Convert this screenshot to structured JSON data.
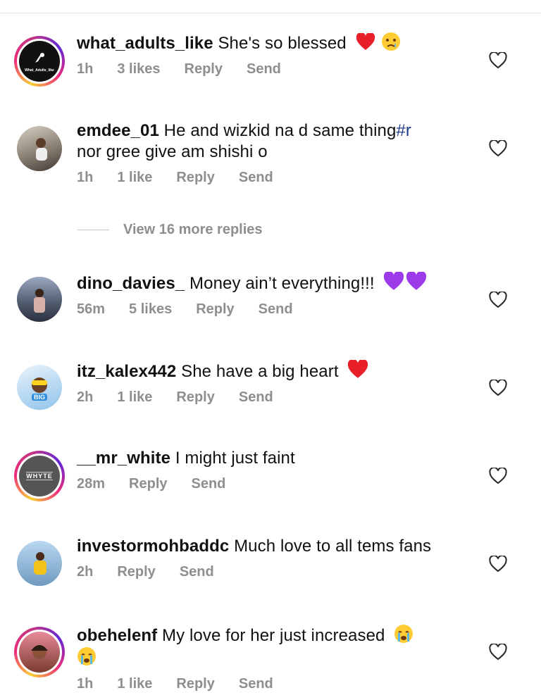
{
  "view_more": "View 16 more replies",
  "comments": [
    {
      "username": "what_adults_like",
      "text": "She's so blessed",
      "time": "1h",
      "likes": "3 likes",
      "reply": "Reply",
      "send": "Send",
      "avatar_text": "What_Adults_like"
    },
    {
      "username": "emdee_01",
      "text": "He and wizkid na d same thing",
      "tag": "#r",
      "text2": "nor gree give am shishi o",
      "time": "1h",
      "likes": "1 like",
      "reply": "Reply",
      "send": "Send"
    },
    {
      "username": "dino_davies_",
      "text": "Money ain’t everything!!!",
      "time": "56m",
      "likes": "5 likes",
      "reply": "Reply",
      "send": "Send"
    },
    {
      "username": "itz_kalex442",
      "text": "She have a big heart",
      "time": "2h",
      "likes": "1 like",
      "reply": "Reply",
      "send": "Send",
      "avatar_text": "BIG"
    },
    {
      "username": "__mr_white",
      "text": "I might just faint",
      "time": "28m",
      "reply": "Reply",
      "send": "Send",
      "avatar_text": "WHYTE"
    },
    {
      "username": "investormohbaddc",
      "text": "Much love to all tems fans",
      "time": "2h",
      "reply": "Reply",
      "send": "Send"
    },
    {
      "username": "obehelenf",
      "text": "My love for her just increased",
      "time": "1h",
      "likes": "1 like",
      "reply": "Reply",
      "send": "Send"
    }
  ],
  "colors": {
    "meta": "#8e8e8e",
    "heart_red": "#e8202a",
    "heart_purple": "#9b3bea",
    "hashtag": "#1e3a8a"
  }
}
